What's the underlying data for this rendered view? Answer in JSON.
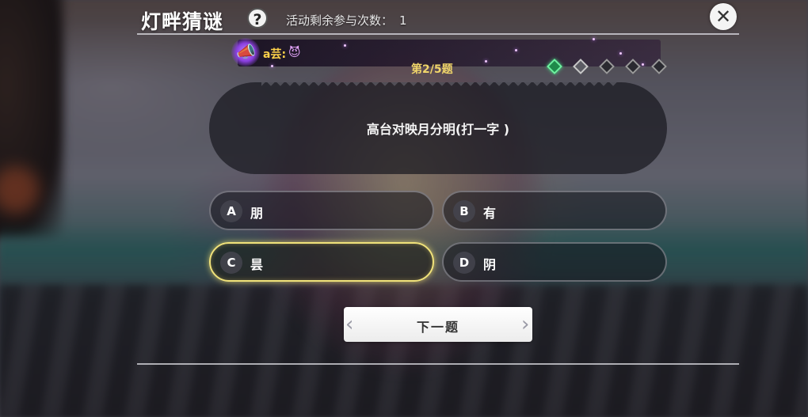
{
  "header": {
    "title": "灯畔猜谜",
    "help_icon": "?",
    "remaining_label": "活动剩余参与次数：",
    "remaining_count": "1",
    "close_icon": "✕"
  },
  "broadcast": {
    "user": "a芸:",
    "message": "😈"
  },
  "progress": {
    "label": "第2/5题",
    "total": 5,
    "states": [
      "done",
      "current",
      "pending",
      "pending",
      "pending"
    ]
  },
  "question": {
    "text": "高台对映月分明(打一字 )"
  },
  "options": [
    {
      "letter": "A",
      "text": "朋",
      "selected": false
    },
    {
      "letter": "B",
      "text": "有",
      "selected": false
    },
    {
      "letter": "C",
      "text": "昙",
      "selected": true
    },
    {
      "letter": "D",
      "text": "阴",
      "selected": false
    }
  ],
  "next_button": {
    "label": "下一题"
  },
  "colors": {
    "progress_gold": "#f0d56a",
    "selected_border": "#f0e27a",
    "gem_done": "#1f8a4a",
    "broadcast_purple": "#e7a7ff"
  }
}
